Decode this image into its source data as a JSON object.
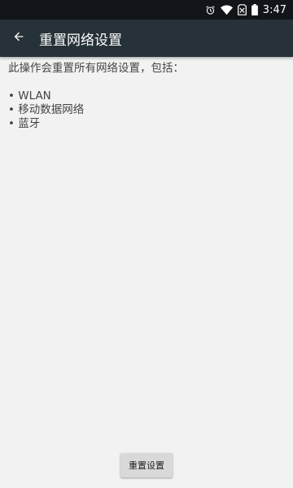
{
  "status_bar": {
    "time": "3:47",
    "icons": [
      "alarm-icon",
      "wifi-icon",
      "sim-no-signal-icon",
      "battery-icon"
    ]
  },
  "app_bar": {
    "title": "重置网络设置",
    "back_icon": "arrow-back-icon"
  },
  "content": {
    "intro": "此操作会重置所有网络设置，包括：",
    "items": [
      "WLAN",
      "移动数据网络",
      "蓝牙"
    ],
    "bullet": "•"
  },
  "actions": {
    "reset_label": "重置设置"
  },
  "colors": {
    "status_bar": "#11151a",
    "app_bar": "#263238",
    "background": "#f2f2f2",
    "button": "#d9d9d9"
  }
}
